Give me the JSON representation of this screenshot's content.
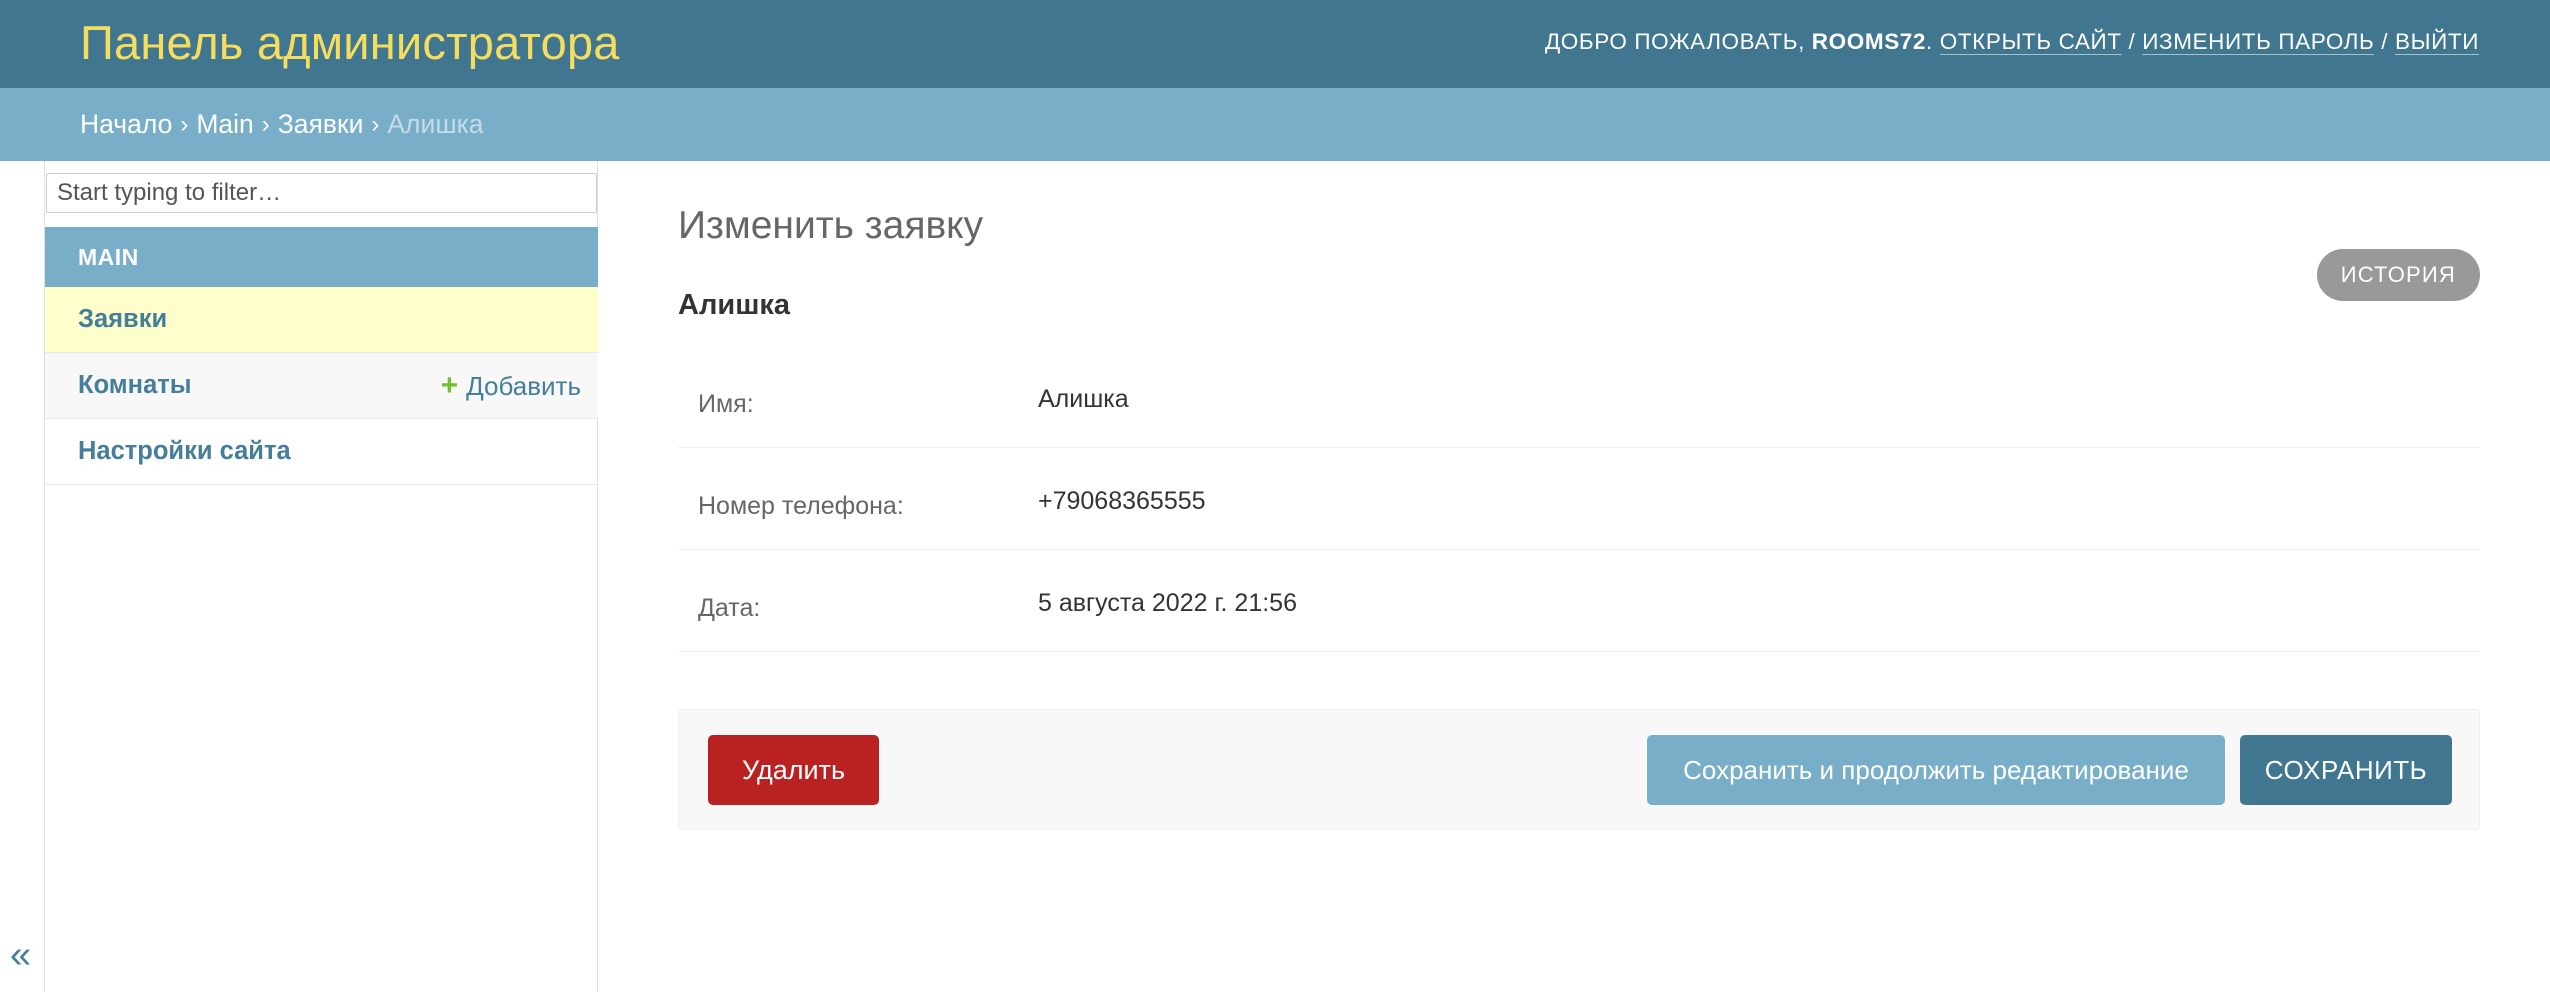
{
  "header": {
    "brand": "Панель администратора",
    "welcome": "Добро пожаловать,",
    "username": "rooms72",
    "open_site": "Открыть сайт",
    "change_password": "Изменить пароль",
    "logout": "Выйти",
    "separator": "/"
  },
  "breadcrumbs": {
    "home": "Начало",
    "app": "Main",
    "model": "Заявки",
    "current": "Алишка",
    "arrow": "›"
  },
  "sidebar": {
    "filter_placeholder": "Start typing to filter…",
    "app_caption": "Main",
    "items": [
      {
        "label": "Заявки",
        "current": true
      },
      {
        "label": "Комнаты",
        "add_label": "Добавить"
      },
      {
        "label": "Настройки сайта"
      }
    ],
    "toggle_glyph": "«"
  },
  "content": {
    "title": "Изменить заявку",
    "history_label": "История",
    "object_name": "Алишка",
    "fields": [
      {
        "label": "Имя:",
        "value": "Алишка"
      },
      {
        "label": "Номер телефона:",
        "value": "+79068365555"
      },
      {
        "label": "Дата:",
        "value": "5 августа 2022 г. 21:56"
      }
    ],
    "delete_label": "Удалить",
    "save_continue_label": "Сохранить и продолжить редактирование",
    "save_label": "Сохранить"
  },
  "colors": {
    "header_bg": "#417690",
    "brand_text": "#f5dd5d",
    "breadcrumbs_bg": "#79aec8",
    "current_item_bg": "#ffffcc",
    "link": "#447e9b",
    "delete_bg": "#ba2121",
    "add_icon": "#70bf2b"
  },
  "icons": {
    "add": "plus-icon",
    "toggle": "double-chevron-left-icon"
  }
}
